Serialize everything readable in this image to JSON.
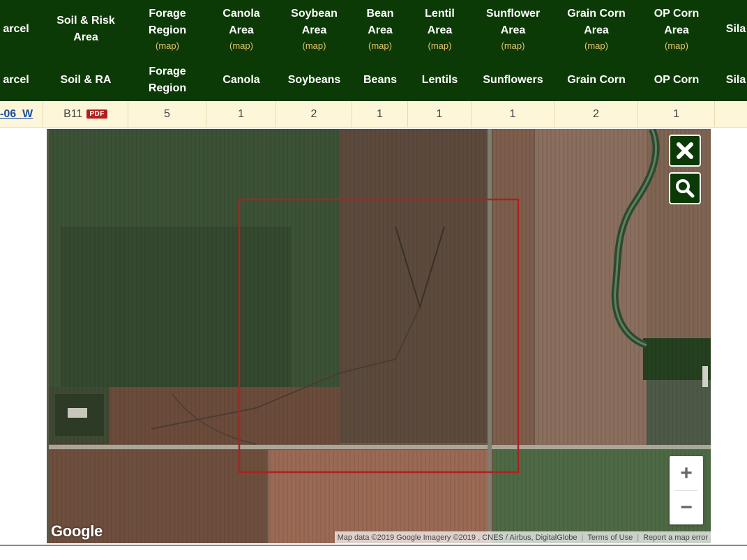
{
  "header_row1": [
    {
      "name": "parcel",
      "lines": [
        "arcel"
      ],
      "map": ""
    },
    {
      "name": "soil-risk-area",
      "lines": [
        "Soil & Risk",
        "Area"
      ],
      "map": ""
    },
    {
      "name": "forage-region",
      "lines": [
        "Forage",
        "Region"
      ],
      "map": "(map)"
    },
    {
      "name": "canola-area",
      "lines": [
        "Canola",
        "Area"
      ],
      "map": "(map)"
    },
    {
      "name": "soybean-area",
      "lines": [
        "Soybean",
        "Area"
      ],
      "map": "(map)"
    },
    {
      "name": "bean-area",
      "lines": [
        "Bean",
        "Area"
      ],
      "map": "(map)"
    },
    {
      "name": "lentil-area",
      "lines": [
        "Lentil",
        "Area"
      ],
      "map": "(map)"
    },
    {
      "name": "sunflower-area",
      "lines": [
        "Sunflower",
        "Area"
      ],
      "map": "(map)"
    },
    {
      "name": "grain-corn-area",
      "lines": [
        "Grain Corn",
        "Area"
      ],
      "map": "(map)"
    },
    {
      "name": "op-corn-area",
      "lines": [
        "OP Corn",
        "Area"
      ],
      "map": "(map)"
    },
    {
      "name": "silage",
      "lines": [
        "Sila"
      ],
      "map": ""
    }
  ],
  "header_row2": [
    {
      "name": "parcel",
      "lines": [
        "arcel"
      ]
    },
    {
      "name": "soil-ra",
      "lines": [
        "Soil & RA"
      ]
    },
    {
      "name": "forage-region",
      "lines": [
        "Forage",
        "Region"
      ]
    },
    {
      "name": "canola",
      "lines": [
        "Canola"
      ]
    },
    {
      "name": "soybeans",
      "lines": [
        "Soybeans"
      ]
    },
    {
      "name": "beans",
      "lines": [
        "Beans"
      ]
    },
    {
      "name": "lentils",
      "lines": [
        "Lentils"
      ]
    },
    {
      "name": "sunflowers",
      "lines": [
        "Sunflowers"
      ]
    },
    {
      "name": "grain-corn",
      "lines": [
        "Grain Corn"
      ]
    },
    {
      "name": "op-corn",
      "lines": [
        "OP Corn"
      ]
    },
    {
      "name": "silage",
      "lines": [
        "Sila"
      ]
    }
  ],
  "data_row": {
    "parcel": "-06_W",
    "soil": "B11",
    "pdf_label": "PDF",
    "cells": [
      "5",
      "1",
      "2",
      "1",
      "1",
      "1",
      "2",
      "1",
      ""
    ]
  },
  "map": {
    "brand": "Google",
    "attribution": "Map data ©2019 Google Imagery ©2019 , CNES / Airbus, DigitalGlobe",
    "terms": "Terms of Use",
    "report": "Report a map error",
    "zoom_in": "+",
    "zoom_out": "−",
    "selection_color": "#b0201f",
    "control_color": "#0c3a06"
  }
}
